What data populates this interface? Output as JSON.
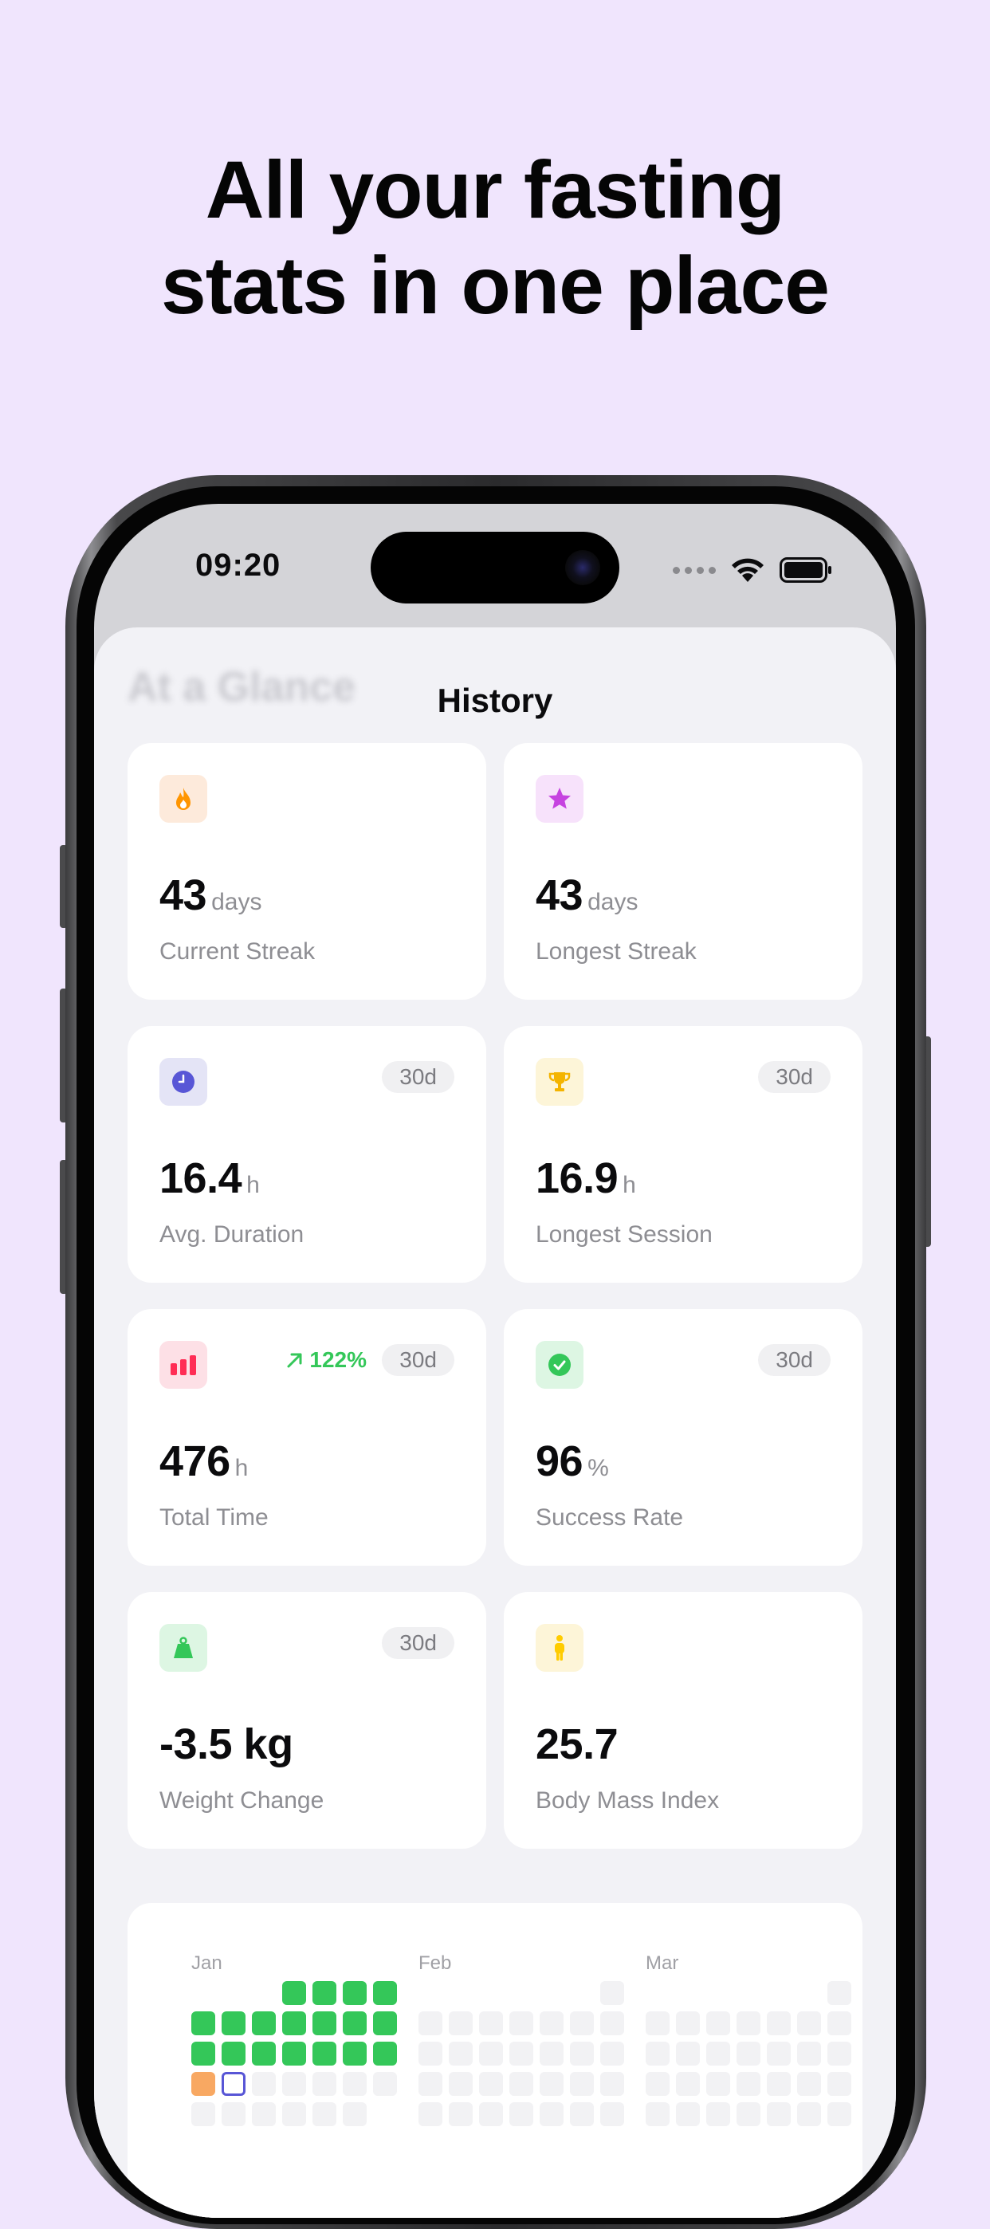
{
  "headline": {
    "line1": "All your fasting",
    "line2": "stats in one place"
  },
  "status_bar": {
    "time": "09:20",
    "icons": [
      "cellular-dots-icon",
      "wifi-icon",
      "battery-icon"
    ]
  },
  "screen": {
    "ghost_title": "At a Glance",
    "nav_title": "History"
  },
  "colors": {
    "background": "#f0e5fd",
    "accent_green": "#34c759",
    "streak_orange": "#ff9500",
    "star_purple": "#c643e0",
    "clock_indigo": "#5856d6",
    "trophy_yellow": "#f4b400",
    "chart_pink": "#ff2d55",
    "bmi_yellow": "#ffcc00"
  },
  "cards": [
    {
      "icon": "flame-icon",
      "badge": "",
      "trend": "",
      "value": "43",
      "unit": "days",
      "label": "Current Streak"
    },
    {
      "icon": "star-icon",
      "badge": "",
      "trend": "",
      "value": "43",
      "unit": "days",
      "label": "Longest Streak"
    },
    {
      "icon": "clock-icon",
      "badge": "30d",
      "trend": "",
      "value": "16.4",
      "unit": "h",
      "label": "Avg. Duration"
    },
    {
      "icon": "trophy-icon",
      "badge": "30d",
      "trend": "",
      "value": "16.9",
      "unit": "h",
      "label": "Longest Session"
    },
    {
      "icon": "bar-chart-icon",
      "badge": "30d",
      "trend": "122%",
      "value": "476",
      "unit": "h",
      "label": "Total Time"
    },
    {
      "icon": "checkmark-icon",
      "badge": "30d",
      "trend": "",
      "value": "96",
      "unit": "%",
      "label": "Success Rate"
    },
    {
      "icon": "scale-icon",
      "badge": "30d",
      "trend": "",
      "value": "-3.5 kg",
      "unit": "",
      "label": "Weight Change"
    },
    {
      "icon": "person-icon",
      "badge": "",
      "trend": "",
      "value": "25.7",
      "unit": "",
      "label": "Body Mass Index"
    }
  ],
  "calendar": {
    "months": [
      "Jan",
      "Feb",
      "Mar"
    ]
  }
}
